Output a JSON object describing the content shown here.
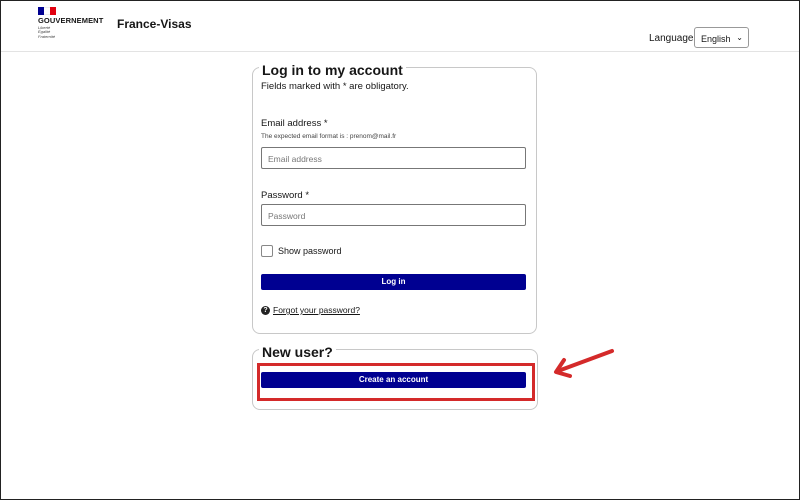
{
  "header": {
    "gov_text": "GOUVERNEMENT",
    "motto": [
      "Liberté",
      "Égalité",
      "Fraternité"
    ],
    "site_title": "France-Visas",
    "language_label": "Language :",
    "language_value": "English"
  },
  "login": {
    "legend": "Log in to my account",
    "required_note": "Fields marked with * are obligatory.",
    "email_label": "Email address *",
    "email_hint": "The expected email format is : prenom@mail.fr",
    "email_placeholder": "Email address",
    "password_label": "Password *",
    "password_placeholder": "Password",
    "show_password": "Show password",
    "login_button": "Log in",
    "forgot_password": "Forgot your password?"
  },
  "new_user": {
    "legend": "New user?",
    "create_button": "Create an account"
  },
  "colors": {
    "primary": "#000091",
    "highlight": "#d42a2a"
  }
}
